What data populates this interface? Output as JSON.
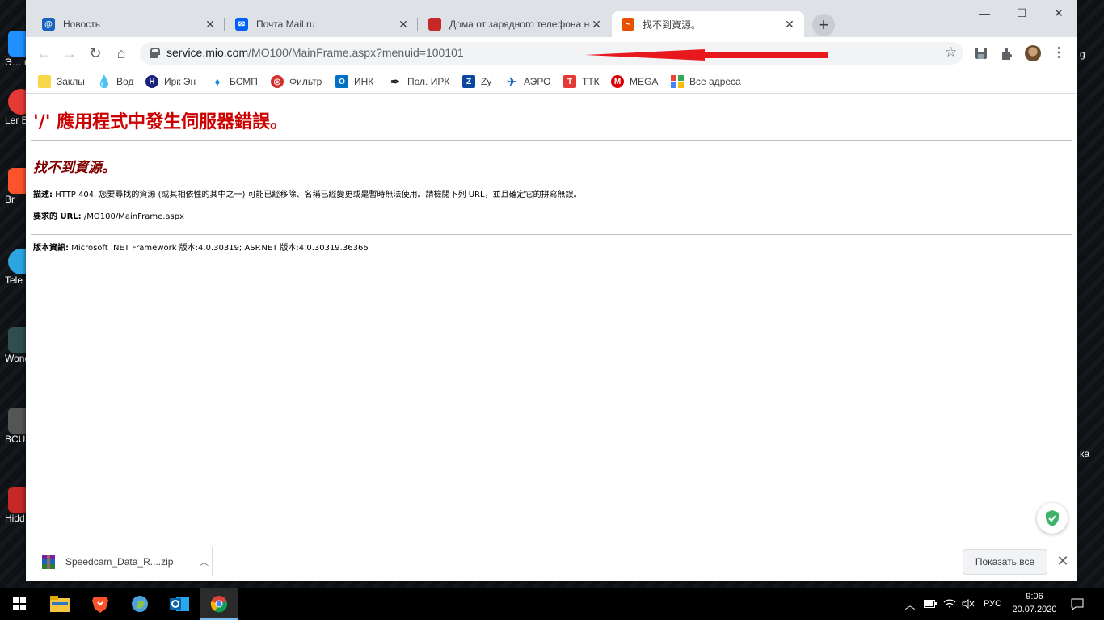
{
  "desktop": {
    "left_icons": [
      {
        "label": "Э… комп…",
        "color": "#1e90ff"
      },
      {
        "label": "Ler Boo",
        "color": "#e53935"
      },
      {
        "label": "Br",
        "color": "#fb542b"
      },
      {
        "label": "Tele",
        "color": "#2ca5e0"
      },
      {
        "label": "Wond Film",
        "color": "#2b2b2b"
      },
      {
        "label": "BCUn",
        "color": "#444"
      },
      {
        "label": "Hidd Fir",
        "color": "#c62828"
      }
    ],
    "right_labels": [
      "g",
      "ка"
    ]
  },
  "browser": {
    "tabs": [
      {
        "title": "Новость",
        "icon": "at-sign-icon",
        "color": "#1565c0",
        "active": false
      },
      {
        "title": "Почта Mail.ru",
        "icon": "mail-icon",
        "color": "#005ff9",
        "active": false
      },
      {
        "title": "Дома от зарядного телефона не",
        "icon": "rss-book-icon",
        "color": "#c62828",
        "active": false
      },
      {
        "title": "找不到資源。",
        "icon": "site-icon",
        "color": "#e65100",
        "active": true
      }
    ],
    "new_tab": "+",
    "window_controls": {
      "minimize": "—",
      "maximize": "☐",
      "close": "✕"
    },
    "url": {
      "host": "service.mio.com",
      "path": "/MO100/MainFrame.aspx?menuid=100101"
    },
    "bookmarks": [
      {
        "label": "Заклы",
        "icon": "folder-icon",
        "color": "#f9d64b"
      },
      {
        "label": "Вод",
        "icon": "drop-icon",
        "color": "#1565c0"
      },
      {
        "label": "Ирк Эн",
        "icon": "hyundai-icon",
        "color": "#1a237e"
      },
      {
        "label": "БСМП",
        "icon": "bsmp-icon",
        "color": "#1e88e5"
      },
      {
        "label": "Фильтр",
        "icon": "filter-icon",
        "color": "#d32f2f"
      },
      {
        "label": "ИНК",
        "icon": "outlook-icon",
        "color": "#0072c6"
      },
      {
        "label": "Пол. ИРК",
        "icon": "pen-icon",
        "color": "#212121"
      },
      {
        "label": "Zy",
        "icon": "z-icon",
        "color": "#0d47a1"
      },
      {
        "label": "АЭРО",
        "icon": "plane-icon",
        "color": "#1565c0"
      },
      {
        "label": "ТТК",
        "icon": "ttk-icon",
        "color": "#e53935"
      },
      {
        "label": "MEGA",
        "icon": "mega-icon",
        "color": "#d90007"
      },
      {
        "label": "Все адреса",
        "icon": "grid-icon",
        "color": "#4285f4"
      }
    ]
  },
  "page": {
    "title": "'/' 應用程式中發生伺服器錯誤。",
    "subtitle": "找不到資源。",
    "desc_label": "描述:",
    "desc_text": "HTTP 404. 您要尋找的資源 (或其相依性的其中之一) 可能已經移除、名稱已經變更或是暫時無法使用。請檢閱下列 URL，並且確定它的拼寫無誤。",
    "url_label": "要求的 URL:",
    "url_value": "/MO100/MainFrame.aspx",
    "version_label": "版本資訊:",
    "version_text": "Microsoft .NET Framework 版本:4.0.30319; ASP.NET 版本:4.0.30319.36366"
  },
  "download_shelf": {
    "file": "Speedcam_Data_R....zip",
    "show_all": "Показать все",
    "close": "✕"
  },
  "taskbar": {
    "apps": [
      "explorer-icon",
      "brave-icon",
      "globe-icon",
      "outlook-icon",
      "chrome-icon"
    ],
    "language": "РУС",
    "time": "9:06",
    "date": "20.07.2020"
  }
}
